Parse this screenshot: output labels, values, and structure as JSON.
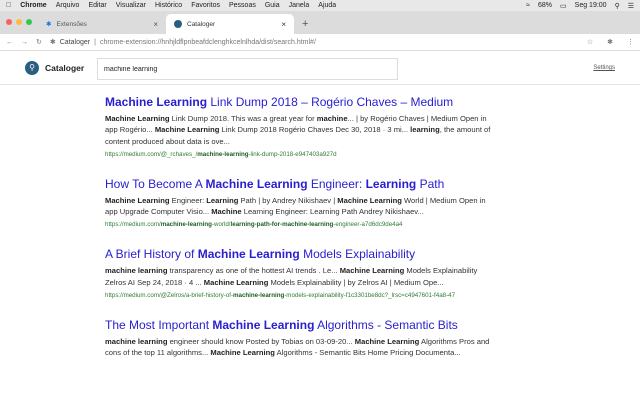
{
  "menubar": {
    "app": "Chrome",
    "items": [
      "Arquivo",
      "Editar",
      "Visualizar",
      "Histórico",
      "Favoritos",
      "Pessoas",
      "Guia",
      "Janela",
      "Ajuda"
    ],
    "battery": "68%",
    "clock": "Seg 19:00"
  },
  "tabs": [
    {
      "label": "Extensões",
      "icon": "puzzle-icon"
    },
    {
      "label": "Cataloger",
      "icon": "cataloger-icon",
      "active": true
    }
  ],
  "address": {
    "site": "Cataloger",
    "url": "chrome-extension://hnhjldflpnbeafdclenghkcelnlhda/dist/search.html#/"
  },
  "header": {
    "brand": "Cataloger",
    "search_value": "machine learning",
    "settings": "Settings"
  },
  "colors": {
    "link": "#2a20d0",
    "url": "#2e7d32",
    "logo": "#2a5d82"
  },
  "results": [
    {
      "title": [
        [
          "Machine Learning",
          1
        ],
        [
          " Link Dump 2018 – Rogério Chaves – Medium",
          0
        ]
      ],
      "snippet": [
        [
          "Machine Learning",
          1
        ],
        [
          " Link Dump 2018. This was a great year for ",
          0
        ],
        [
          "machine",
          1
        ],
        [
          "... | by Rogério Chaves | Medium Open in app Rogério... ",
          0
        ],
        [
          "Machine Learning",
          1
        ],
        [
          " Link Dump 2018 Rogério Chaves Dec 30, 2018 · 3 mi... ",
          0
        ],
        [
          "learning",
          1
        ],
        [
          ", the amount of content produced about data is ove...",
          0
        ]
      ],
      "url": [
        [
          "https://medium.com/@_rchaves_/",
          0
        ],
        [
          "machine-learning",
          1
        ],
        [
          "-link-dump-2018-e947403a927d",
          0
        ]
      ]
    },
    {
      "title": [
        [
          "How To Become A ",
          0
        ],
        [
          "Machine Learning",
          1
        ],
        [
          " Engineer: ",
          0
        ],
        [
          "Learning",
          1
        ],
        [
          " Path",
          0
        ]
      ],
      "snippet": [
        [
          "Machine Learning",
          1
        ],
        [
          " Engineer: ",
          0
        ],
        [
          "Learning",
          1
        ],
        [
          " Path | by Andrey Nikishaev | ",
          0
        ],
        [
          "Machine Learning",
          1
        ],
        [
          " World | Medium Open in app Upgrade Computer Visio... ",
          0
        ],
        [
          "Machine",
          1
        ],
        [
          " Learning Engineer: Learning Path Andrey Nikishaev...",
          0
        ]
      ],
      "url": [
        [
          "https://medium.com/",
          0
        ],
        [
          "machine-learning",
          1
        ],
        [
          "-world/",
          0
        ],
        [
          "learning-path-for-machine-learning",
          1
        ],
        [
          "-engineer-a7d6dc9de4a4",
          0
        ]
      ]
    },
    {
      "title": [
        [
          "A Brief History of ",
          0
        ],
        [
          "Machine Learning",
          1
        ],
        [
          " Models Explainability",
          0
        ]
      ],
      "snippet": [
        [
          "machine learning",
          1
        ],
        [
          " transparency as one of the hottest AI trends . Le... ",
          0
        ],
        [
          "Machine Learning",
          1
        ],
        [
          " Models Explainability Zelros AI Sep 24, 2018 · 4 ... ",
          0
        ],
        [
          "Machine Learning",
          1
        ],
        [
          " Models Explainability | by Zelros AI | Medium Ope...",
          0
        ]
      ],
      "url": [
        [
          "https://medium.com/@Zelros/a-brief-history-of-",
          0
        ],
        [
          "machine-learning",
          1
        ],
        [
          "-models-explainability-f1c3301be8dc?_lrsc=c4947601-f4a8-47",
          0
        ]
      ]
    },
    {
      "title": [
        [
          "The Most Important ",
          0
        ],
        [
          "Machine Learning",
          1
        ],
        [
          " Algorithms - Semantic Bits",
          0
        ]
      ],
      "snippet": [
        [
          "machine learning",
          1
        ],
        [
          " engineer should know Posted by Tobias on 03-09-20... ",
          0
        ],
        [
          "Machine Learning",
          1
        ],
        [
          " Algorithms Pros and cons of the top 11 algorithms... ",
          0
        ],
        [
          "Machine Learning",
          1
        ],
        [
          " Algorithms - Semantic Bits Home Pricing Documenta...",
          0
        ]
      ],
      "url": []
    }
  ]
}
